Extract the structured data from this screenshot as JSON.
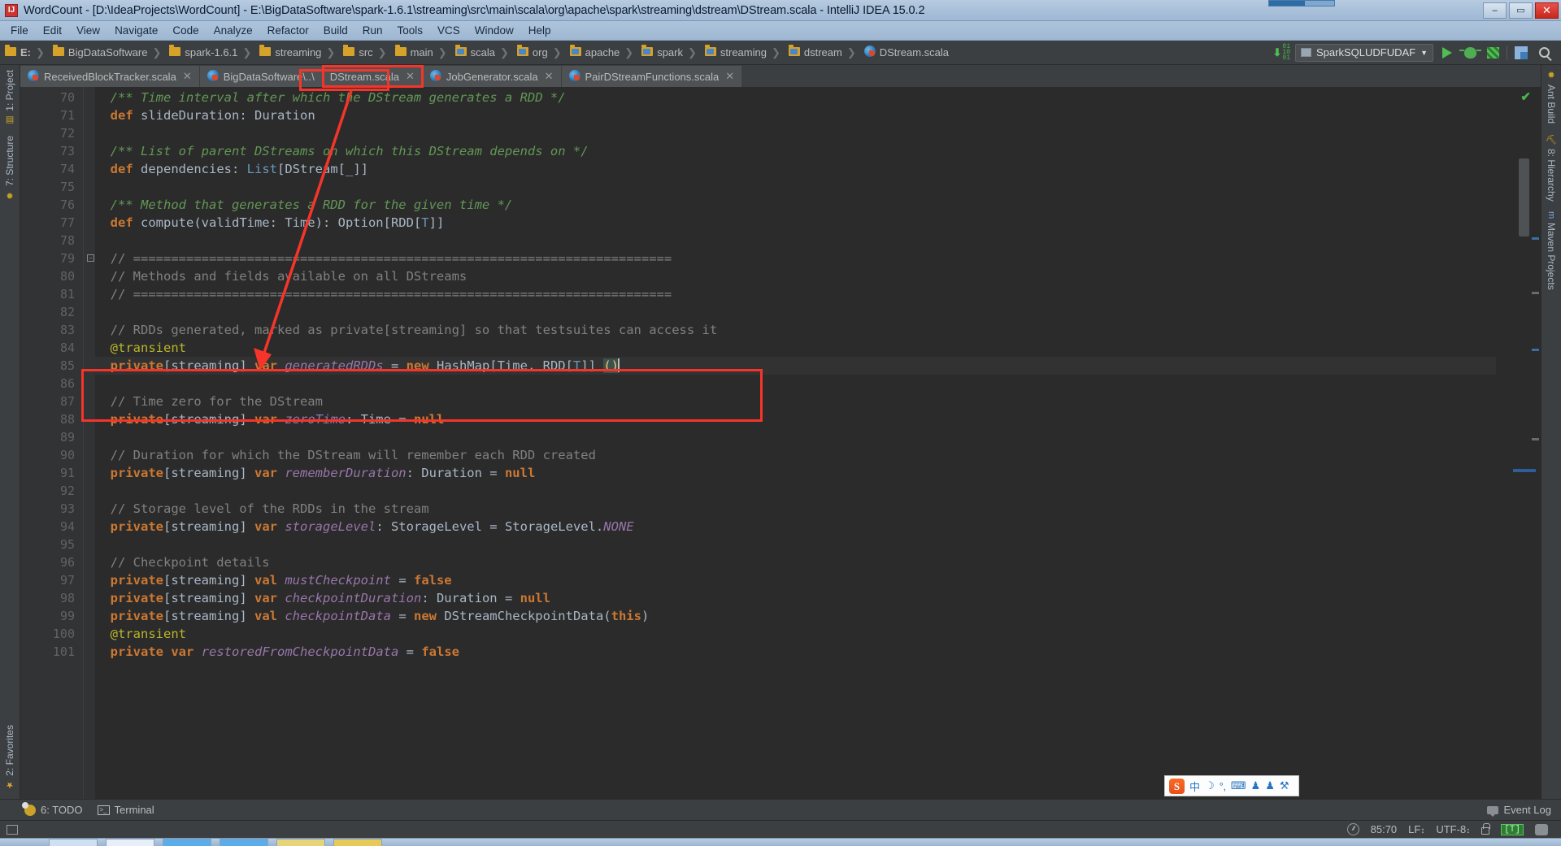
{
  "window": {
    "title": "WordCount - [D:\\IdeaProjects\\WordCount] - E:\\BigDataSoftware\\spark-1.6.1\\streaming\\src\\main\\scala\\org\\apache\\spark\\streaming\\dstream\\DStream.scala - IntelliJ IDEA 15.0.2",
    "app_icon": "intellij-idea-icon",
    "minimize_label": "–",
    "maximize_label": "▭",
    "close_label": "✕"
  },
  "menubar": {
    "items": [
      "File",
      "Edit",
      "View",
      "Navigate",
      "Code",
      "Analyze",
      "Refactor",
      "Build",
      "Run",
      "Tools",
      "VCS",
      "Window",
      "Help"
    ]
  },
  "navbar": {
    "breadcrumbs": [
      {
        "label": "E:",
        "icon": "folder-icon"
      },
      {
        "label": "BigDataSoftware",
        "icon": "folder-icon"
      },
      {
        "label": "spark-1.6.1",
        "icon": "folder-icon"
      },
      {
        "label": "streaming",
        "icon": "folder-icon"
      },
      {
        "label": "src",
        "icon": "folder-icon"
      },
      {
        "label": "main",
        "icon": "folder-icon"
      },
      {
        "label": "scala",
        "icon": "source-folder-icon"
      },
      {
        "label": "org",
        "icon": "source-folder-icon"
      },
      {
        "label": "apache",
        "icon": "source-folder-icon"
      },
      {
        "label": "spark",
        "icon": "source-folder-icon"
      },
      {
        "label": "streaming",
        "icon": "source-folder-icon"
      },
      {
        "label": "dstream",
        "icon": "source-folder-icon"
      },
      {
        "label": "DStream.scala",
        "icon": "scala-file-icon"
      }
    ],
    "run_config": "SparkSQLUDFUDAF",
    "dropdown_caret": "▼",
    "buttons": [
      {
        "name": "run-button",
        "icon": "play-icon"
      },
      {
        "name": "debug-button",
        "icon": "bug-icon"
      },
      {
        "name": "coverage-button",
        "icon": "coverage-icon"
      },
      {
        "name": "build-button",
        "icon": "build-project-icon"
      },
      {
        "name": "search-everywhere-button",
        "icon": "search-icon"
      }
    ]
  },
  "left_tool_strip": {
    "top_items": [
      {
        "label": "1: Project",
        "icon": "project-icon"
      },
      {
        "label": "7: Structure",
        "icon": "structure-icon"
      }
    ],
    "bottom_items": [
      {
        "label": "2: Favorites",
        "icon": "star-icon"
      }
    ]
  },
  "right_tool_strip": {
    "items": [
      {
        "label": "Ant Build",
        "icon": "ant-icon"
      },
      {
        "label": "8: Hierarchy",
        "icon": "hierarchy-icon"
      },
      {
        "label": "Maven Projects",
        "icon": "maven-icon"
      }
    ]
  },
  "editor_tabs": [
    {
      "label": "ReceivedBlockTracker.scala",
      "icon": "scala-file-icon",
      "active": false,
      "highlighted": false,
      "close": "✕"
    },
    {
      "label": "BigDataSoftware\\..\\",
      "icon": "scala-file-icon",
      "active": false,
      "highlighted": false,
      "close": ""
    },
    {
      "label": "DStream.scala",
      "icon": "",
      "active": true,
      "highlighted": true,
      "close": "✕"
    },
    {
      "label": "JobGenerator.scala",
      "icon": "scala-file-icon",
      "active": false,
      "highlighted": false,
      "close": "✕"
    },
    {
      "label": "PairDStreamFunctions.scala",
      "icon": "scala-file-icon",
      "active": false,
      "highlighted": false,
      "close": "✕"
    }
  ],
  "editor": {
    "first_line": 70,
    "current_line": 85,
    "lines": [
      {
        "n": 70,
        "tokens": [
          {
            "t": "  /** Time interval after which the DStream generates a RDD */",
            "c": "doc"
          }
        ]
      },
      {
        "n": 71,
        "tokens": [
          {
            "t": "  ",
            "c": "typ"
          },
          {
            "t": "def",
            "c": "kw"
          },
          {
            "t": " slideDuration",
            "c": "typ"
          },
          {
            "t": ": Duration",
            "c": "typ"
          }
        ]
      },
      {
        "n": 72,
        "tokens": []
      },
      {
        "n": 73,
        "tokens": [
          {
            "t": "  /** List of parent DStreams on which this DStream depends on */",
            "c": "doc"
          }
        ]
      },
      {
        "n": 74,
        "tokens": [
          {
            "t": "  ",
            "c": "typ"
          },
          {
            "t": "def",
            "c": "kw"
          },
          {
            "t": " dependencies",
            "c": "typ"
          },
          {
            "t": ": ",
            "c": "typ"
          },
          {
            "t": "List",
            "c": "tp"
          },
          {
            "t": "[DStream[_]]",
            "c": "typ"
          }
        ]
      },
      {
        "n": 75,
        "tokens": []
      },
      {
        "n": 76,
        "tokens": [
          {
            "t": "  /** Method that generates a RDD for the given time */",
            "c": "doc"
          }
        ]
      },
      {
        "n": 77,
        "tokens": [
          {
            "t": "  ",
            "c": "typ"
          },
          {
            "t": "def",
            "c": "kw"
          },
          {
            "t": " compute(validTime: ",
            "c": "typ"
          },
          {
            "t": "Time",
            "c": "typ"
          },
          {
            "t": "): Option[RDD[",
            "c": "typ"
          },
          {
            "t": "T",
            "c": "tp"
          },
          {
            "t": "]]",
            "c": "typ"
          }
        ]
      },
      {
        "n": 78,
        "tokens": []
      },
      {
        "n": 79,
        "tokens": [
          {
            "t": "  // =======================================================================",
            "c": "cmt"
          }
        ],
        "fold": true
      },
      {
        "n": 80,
        "tokens": [
          {
            "t": "  // Methods and fields available on all DStreams",
            "c": "cmt"
          }
        ]
      },
      {
        "n": 81,
        "tokens": [
          {
            "t": "  // =======================================================================",
            "c": "cmt"
          }
        ]
      },
      {
        "n": 82,
        "tokens": []
      },
      {
        "n": 83,
        "tokens": [
          {
            "t": "  // RDDs generated, marked as private[streaming] so that testsuites can access it",
            "c": "cmt"
          }
        ]
      },
      {
        "n": 84,
        "tokens": [
          {
            "t": "  ",
            "c": "typ"
          },
          {
            "t": "@transient",
            "c": "ann"
          }
        ]
      },
      {
        "n": 85,
        "tokens": [
          {
            "t": "  ",
            "c": "typ"
          },
          {
            "t": "private",
            "c": "kw"
          },
          {
            "t": "[streaming] ",
            "c": "typ"
          },
          {
            "t": "var",
            "c": "kw"
          },
          {
            "t": " ",
            "c": "typ"
          },
          {
            "t": "generatedRDDs",
            "c": "fld"
          },
          {
            "t": " = ",
            "c": "typ"
          },
          {
            "t": "new",
            "c": "kw"
          },
          {
            "t": " HashMap[Time, RDD[",
            "c": "typ"
          },
          {
            "t": "T",
            "c": "tp"
          },
          {
            "t": "]] ",
            "c": "typ"
          },
          {
            "t": "()",
            "c": "brk"
          }
        ]
      },
      {
        "n": 86,
        "tokens": []
      },
      {
        "n": 87,
        "tokens": [
          {
            "t": "  // Time zero for the DStream",
            "c": "cmt"
          }
        ]
      },
      {
        "n": 88,
        "tokens": [
          {
            "t": "  ",
            "c": "typ"
          },
          {
            "t": "private",
            "c": "kw"
          },
          {
            "t": "[streaming] ",
            "c": "typ"
          },
          {
            "t": "var",
            "c": "kw"
          },
          {
            "t": " ",
            "c": "typ"
          },
          {
            "t": "zeroTime",
            "c": "fld"
          },
          {
            "t": ": Time = ",
            "c": "typ"
          },
          {
            "t": "null",
            "c": "kw"
          }
        ]
      },
      {
        "n": 89,
        "tokens": []
      },
      {
        "n": 90,
        "tokens": [
          {
            "t": "  // Duration for which the DStream will remember each RDD created",
            "c": "cmt"
          }
        ]
      },
      {
        "n": 91,
        "tokens": [
          {
            "t": "  ",
            "c": "typ"
          },
          {
            "t": "private",
            "c": "kw"
          },
          {
            "t": "[streaming] ",
            "c": "typ"
          },
          {
            "t": "var",
            "c": "kw"
          },
          {
            "t": " ",
            "c": "typ"
          },
          {
            "t": "rememberDuration",
            "c": "fld"
          },
          {
            "t": ": Duration = ",
            "c": "typ"
          },
          {
            "t": "null",
            "c": "kw"
          }
        ]
      },
      {
        "n": 92,
        "tokens": []
      },
      {
        "n": 93,
        "tokens": [
          {
            "t": "  // Storage level of the RDDs in the stream",
            "c": "cmt"
          }
        ]
      },
      {
        "n": 94,
        "tokens": [
          {
            "t": "  ",
            "c": "typ"
          },
          {
            "t": "private",
            "c": "kw"
          },
          {
            "t": "[streaming] ",
            "c": "typ"
          },
          {
            "t": "var",
            "c": "kw"
          },
          {
            "t": " ",
            "c": "typ"
          },
          {
            "t": "storageLevel",
            "c": "fld"
          },
          {
            "t": ": StorageLevel = StorageLevel.",
            "c": "typ"
          },
          {
            "t": "NONE",
            "c": "stc"
          }
        ]
      },
      {
        "n": 95,
        "tokens": []
      },
      {
        "n": 96,
        "tokens": [
          {
            "t": "  // Checkpoint details",
            "c": "cmt"
          }
        ]
      },
      {
        "n": 97,
        "tokens": [
          {
            "t": "  ",
            "c": "typ"
          },
          {
            "t": "private",
            "c": "kw"
          },
          {
            "t": "[streaming] ",
            "c": "typ"
          },
          {
            "t": "val",
            "c": "kw"
          },
          {
            "t": " ",
            "c": "typ"
          },
          {
            "t": "mustCheckpoint",
            "c": "fld"
          },
          {
            "t": " = ",
            "c": "typ"
          },
          {
            "t": "false",
            "c": "kw"
          }
        ]
      },
      {
        "n": 98,
        "tokens": [
          {
            "t": "  ",
            "c": "typ"
          },
          {
            "t": "private",
            "c": "kw"
          },
          {
            "t": "[streaming] ",
            "c": "typ"
          },
          {
            "t": "var",
            "c": "kw"
          },
          {
            "t": " ",
            "c": "typ"
          },
          {
            "t": "checkpointDuration",
            "c": "fld"
          },
          {
            "t": ": Duration = ",
            "c": "typ"
          },
          {
            "t": "null",
            "c": "kw"
          }
        ]
      },
      {
        "n": 99,
        "tokens": [
          {
            "t": "  ",
            "c": "typ"
          },
          {
            "t": "private",
            "c": "kw"
          },
          {
            "t": "[streaming] ",
            "c": "typ"
          },
          {
            "t": "val",
            "c": "kw"
          },
          {
            "t": " ",
            "c": "typ"
          },
          {
            "t": "checkpointData",
            "c": "fld"
          },
          {
            "t": " = ",
            "c": "typ"
          },
          {
            "t": "new",
            "c": "kw"
          },
          {
            "t": " DStreamCheckpointData(",
            "c": "typ"
          },
          {
            "t": "this",
            "c": "kw"
          },
          {
            "t": ")",
            "c": "typ"
          }
        ]
      },
      {
        "n": 100,
        "tokens": [
          {
            "t": "  ",
            "c": "typ"
          },
          {
            "t": "@transient",
            "c": "ann"
          }
        ]
      },
      {
        "n": 101,
        "tokens": [
          {
            "t": "  ",
            "c": "typ"
          },
          {
            "t": "private",
            "c": "kw"
          },
          {
            "t": " ",
            "c": "typ"
          },
          {
            "t": "var",
            "c": "kw"
          },
          {
            "t": " ",
            "c": "typ"
          },
          {
            "t": "restoredFromCheckpointData",
            "c": "fld"
          },
          {
            "t": " = ",
            "c": "typ"
          },
          {
            "t": "false",
            "c": "kw"
          }
        ]
      }
    ],
    "annotation_color": "#f5352a",
    "inspection_status": "ok-check-icon"
  },
  "bottom_bar": {
    "tools": [
      {
        "label": "6: TODO",
        "icon": "todo-icon"
      },
      {
        "label": "Terminal",
        "icon": "terminal-icon"
      }
    ],
    "event_log": "Event Log"
  },
  "status_bar": {
    "caret_position": "85:70",
    "line_separator": "LF",
    "encoding": "UTF-8",
    "lock_icon": "unlocked-icon",
    "indent_badge": "[T]",
    "avatar_icon": "user-icon",
    "gauge_icon": "memory-gauge-icon",
    "sep_caret": "↕"
  },
  "ime_bar": {
    "logo": "S",
    "items": [
      "中",
      "☽",
      "°‚",
      "⌨",
      "♟",
      "♟",
      "⚒"
    ]
  },
  "colors": {
    "editor_bg": "#2b2b2b",
    "gutter_bg": "#313335",
    "chrome_bg": "#3c3f41",
    "title_bg": "#a9c0da",
    "keyword": "#cc7832",
    "comment": "#808080",
    "scaladoc": "#629755",
    "field": "#9876aa",
    "type": "#6897bb",
    "annotation": "#bbb529",
    "default_text": "#a9b7c6",
    "annotation_red": "#f5352a",
    "accent_green": "#4fbf52"
  }
}
